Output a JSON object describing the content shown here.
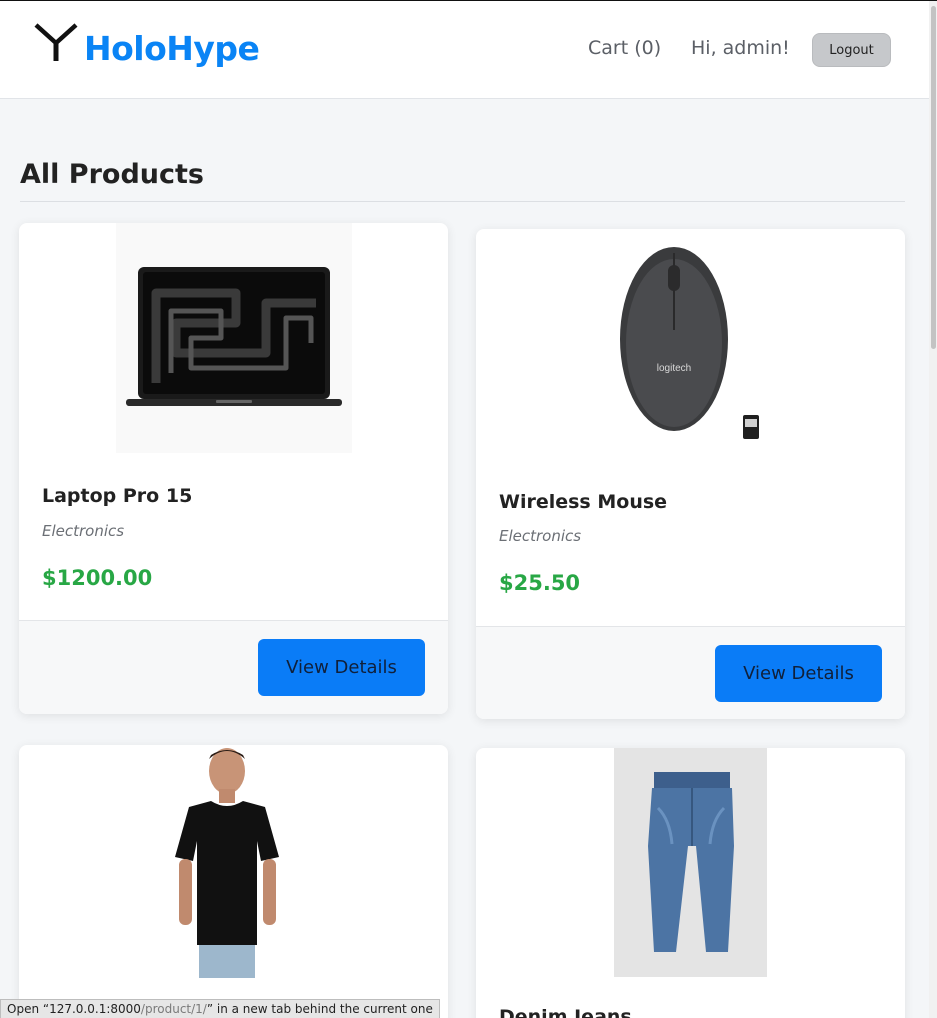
{
  "header": {
    "brand": "HoloHype",
    "cart": "Cart (0)",
    "greeting": "Hi, admin!",
    "logout": "Logout"
  },
  "main": {
    "title": "All Products"
  },
  "products": [
    {
      "name": "Laptop Pro 15",
      "category": "Electronics",
      "price": "$1200.00",
      "button": "View Details",
      "image": "laptop-image"
    },
    {
      "name": "Wireless Mouse",
      "category": "Electronics",
      "price": "$25.50",
      "button": "View Details",
      "image": "mouse-image"
    },
    {
      "name": "",
      "category": "",
      "price": "",
      "button": "",
      "image": "tshirt-image"
    },
    {
      "name": "Denim Jeans",
      "category": "",
      "price": "",
      "button": "",
      "image": "jeans-image"
    }
  ],
  "statusbar": {
    "prefix": "Open “127.0.0.1:8000",
    "path": "/product/1/",
    "suffix": "” in a new tab behind the current one"
  },
  "colors": {
    "brand": "#0a84f5",
    "price": "#28a745",
    "button": "#0a7cf7"
  }
}
